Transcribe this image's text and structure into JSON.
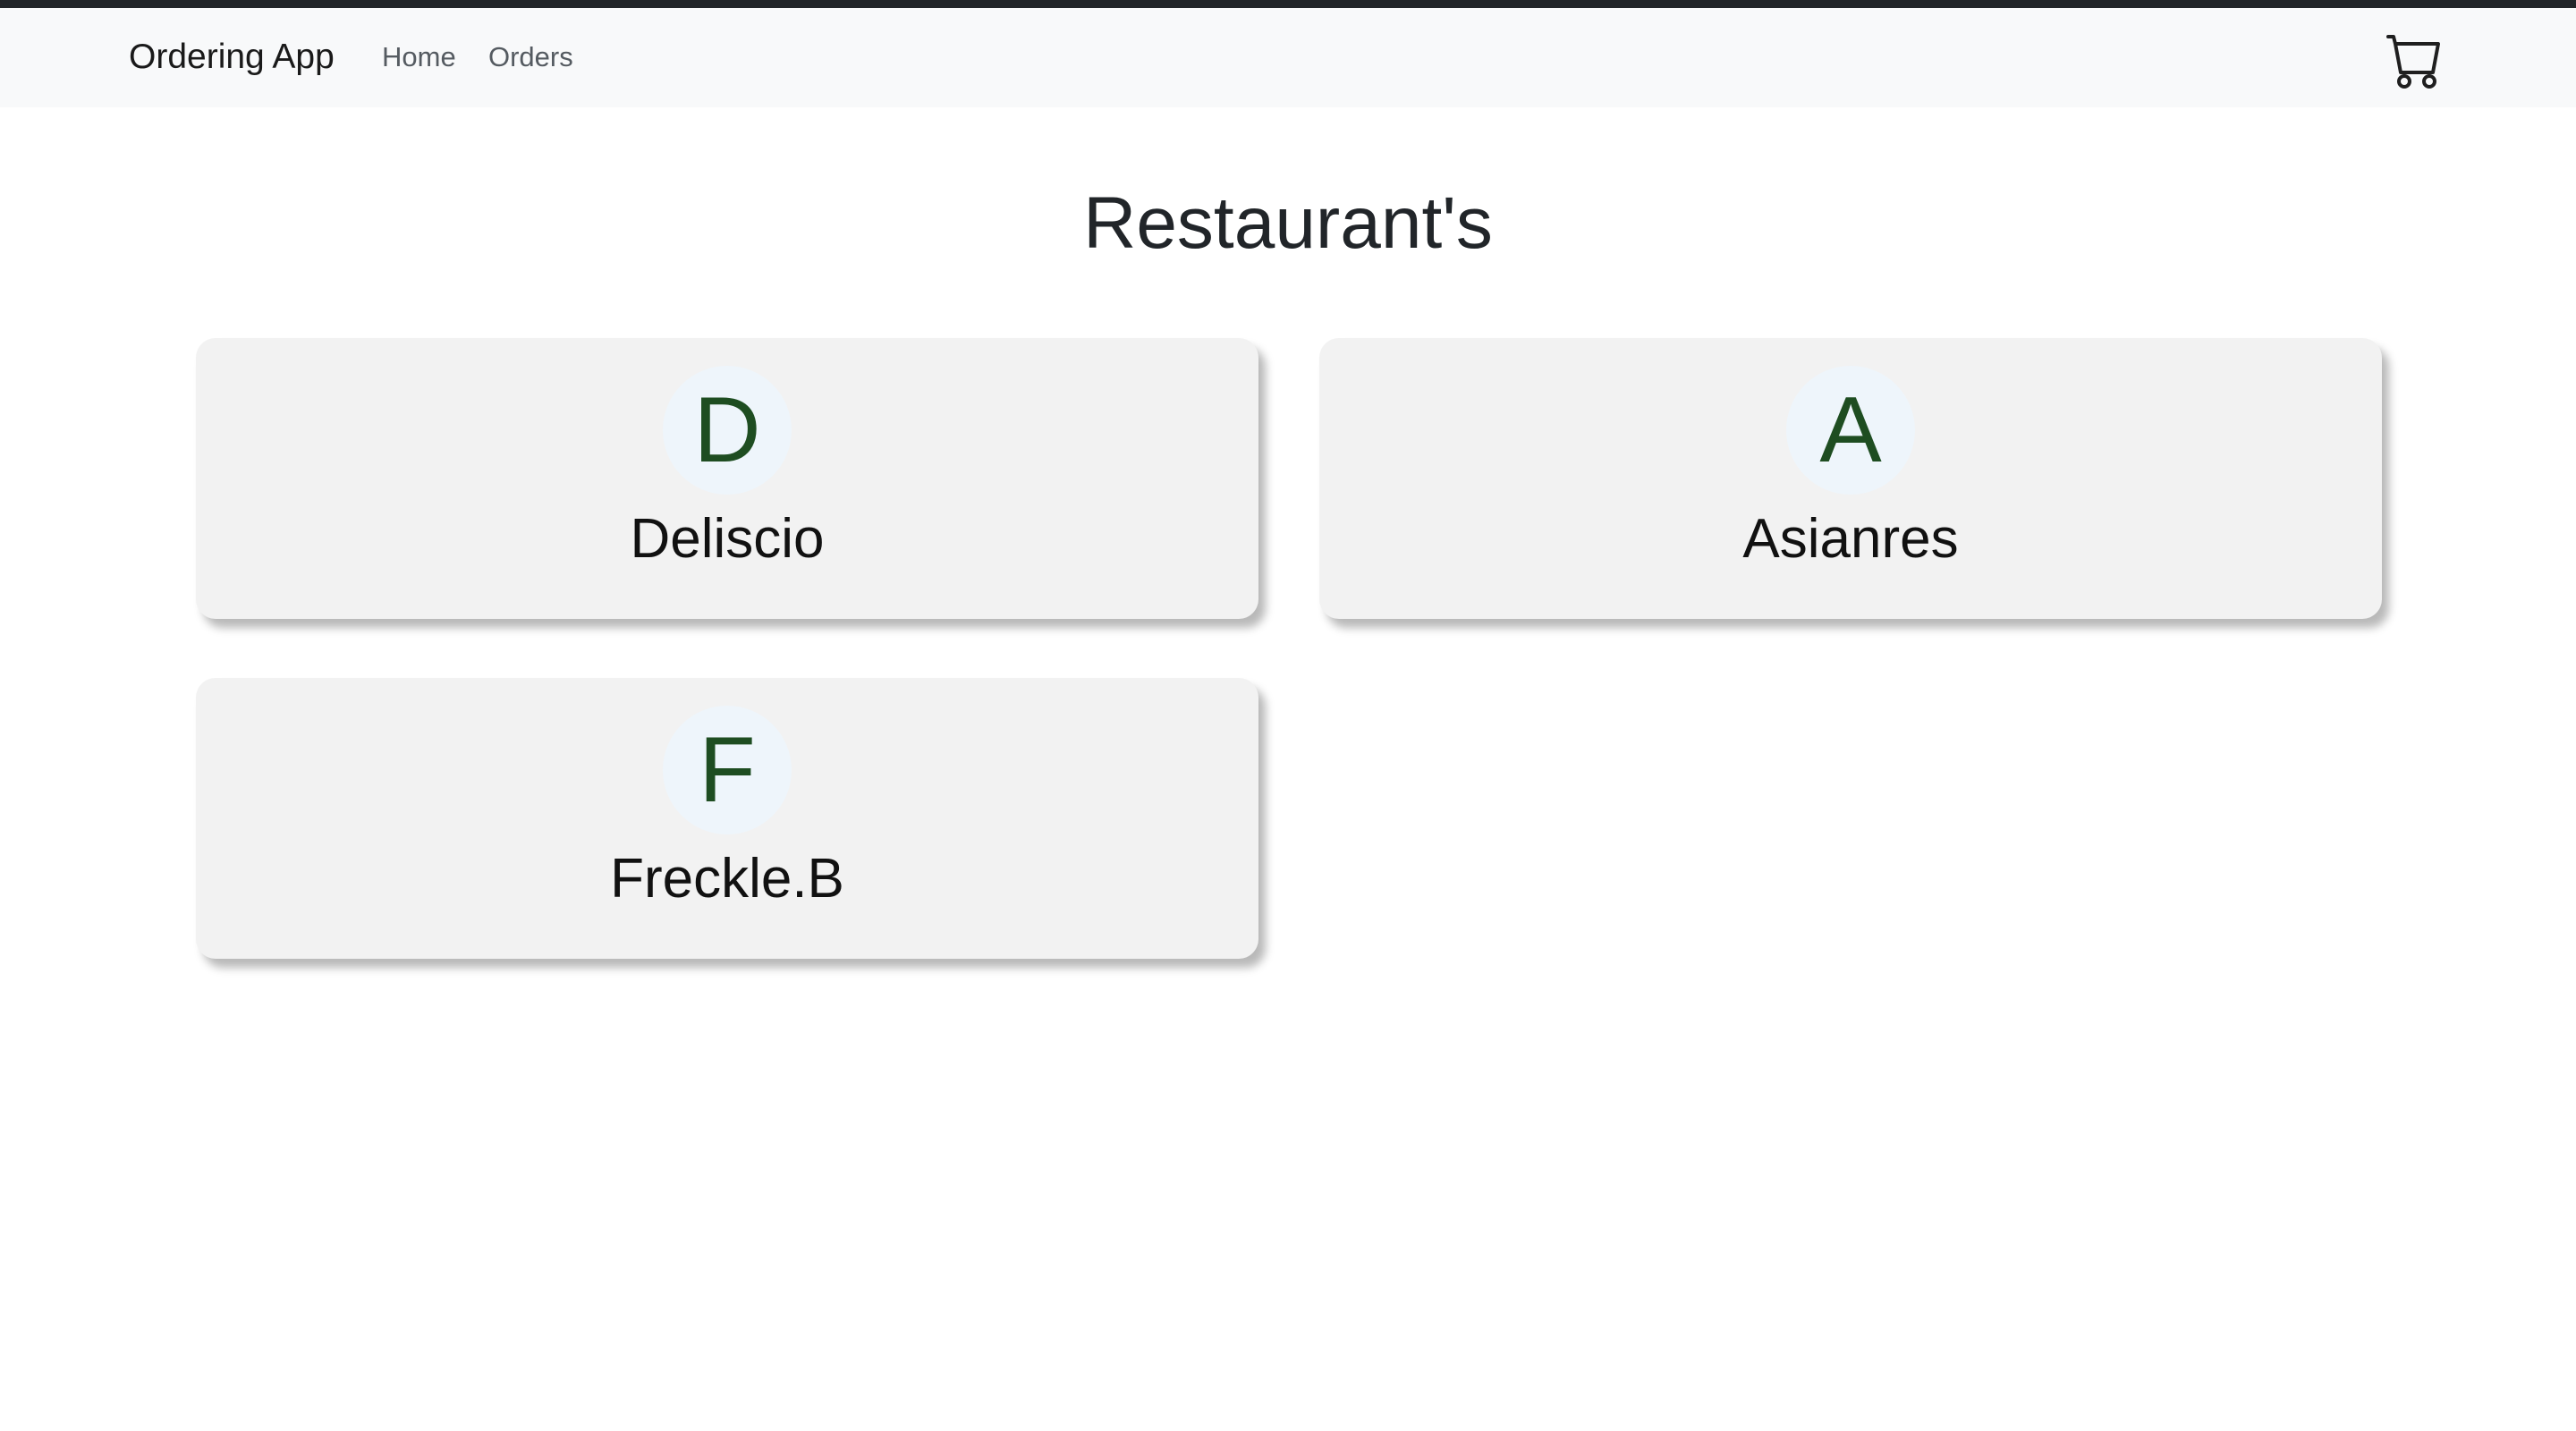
{
  "navbar": {
    "brand": "Ordering App",
    "links": [
      {
        "label": "Home"
      },
      {
        "label": "Orders"
      }
    ],
    "cart_icon": "shopping-cart-icon"
  },
  "page": {
    "title": "Restaurant's"
  },
  "restaurants": [
    {
      "initial": "D",
      "name": "Deliscio"
    },
    {
      "initial": "A",
      "name": "Asianres"
    },
    {
      "initial": "F",
      "name": "Freckle.B"
    }
  ],
  "colors": {
    "top_strip": "#212529",
    "navbar_bg": "#f8f9fa",
    "card_bg": "#f2f2f2",
    "avatar_bg": "#eef5fb",
    "avatar_letter": "#1e4d21"
  }
}
